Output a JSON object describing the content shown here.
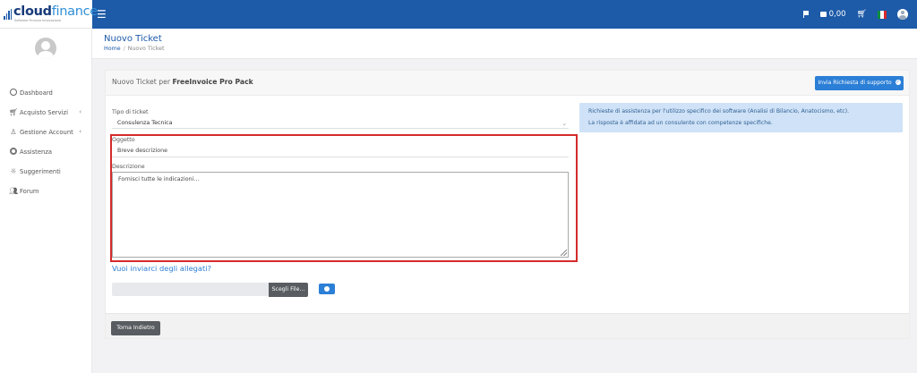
{
  "brand": {
    "logo_cloud": "cloud",
    "logo_finance": "finance",
    "logo_tagline": "Software Finanza Innovazione",
    "primary_color": "#1d5aa8",
    "accent_color": "#2b7fd6",
    "highlight_color": "#d52a2a"
  },
  "topbar": {
    "menu_icon": "hamburger-icon",
    "credit": "0,00",
    "icons": [
      "flag-icon",
      "wallet-icon",
      "cart-icon",
      "italy-flag-icon",
      "user-icon"
    ]
  },
  "sidebar": {
    "items": [
      {
        "label": "Dashboard",
        "icon": "dashboard-icon",
        "chevron": ""
      },
      {
        "label": "Acquisto Servizi",
        "icon": "cart-icon",
        "chevron": "‹"
      },
      {
        "label": "Gestione Account",
        "icon": "user-icon",
        "chevron": "‹"
      },
      {
        "label": "Assistenza",
        "icon": "lifebuoy-icon",
        "chevron": ""
      },
      {
        "label": "Suggerimenti",
        "icon": "lightbulb-icon",
        "chevron": ""
      },
      {
        "label": "Forum",
        "icon": "users-icon",
        "chevron": ""
      }
    ]
  },
  "header": {
    "title": "Nuovo Ticket",
    "breadcrumb": {
      "home": "Home",
      "separator": "/",
      "current": "Nuovo Ticket"
    }
  },
  "card": {
    "title_prefix": "Nuovo Ticket per",
    "product": "FreeInvoice Pro Pack",
    "support_button": "Invia Richiesta di supporto"
  },
  "form": {
    "ticket_type_label": "Tipo di ticket",
    "ticket_type_value": "Consulenza Tecnica",
    "subject_label": "Oggetto",
    "subject_placeholder": "Breve descrizione",
    "description_label": "Descrizione",
    "description_placeholder": "Fornisci tutte le indicazioni...",
    "attachments_link": "Vuoi inviarci degli allegati?",
    "file_button": "Scegli File...",
    "back_button": "Torna Indietro"
  },
  "info": {
    "line1": "Richieste di assistenza per l'utilizzo specifico dei software (Analisi di Bilancio, Anatocismo, etc).",
    "line2": "La risposta è affidata ad un consulente con competenze specifiche."
  }
}
